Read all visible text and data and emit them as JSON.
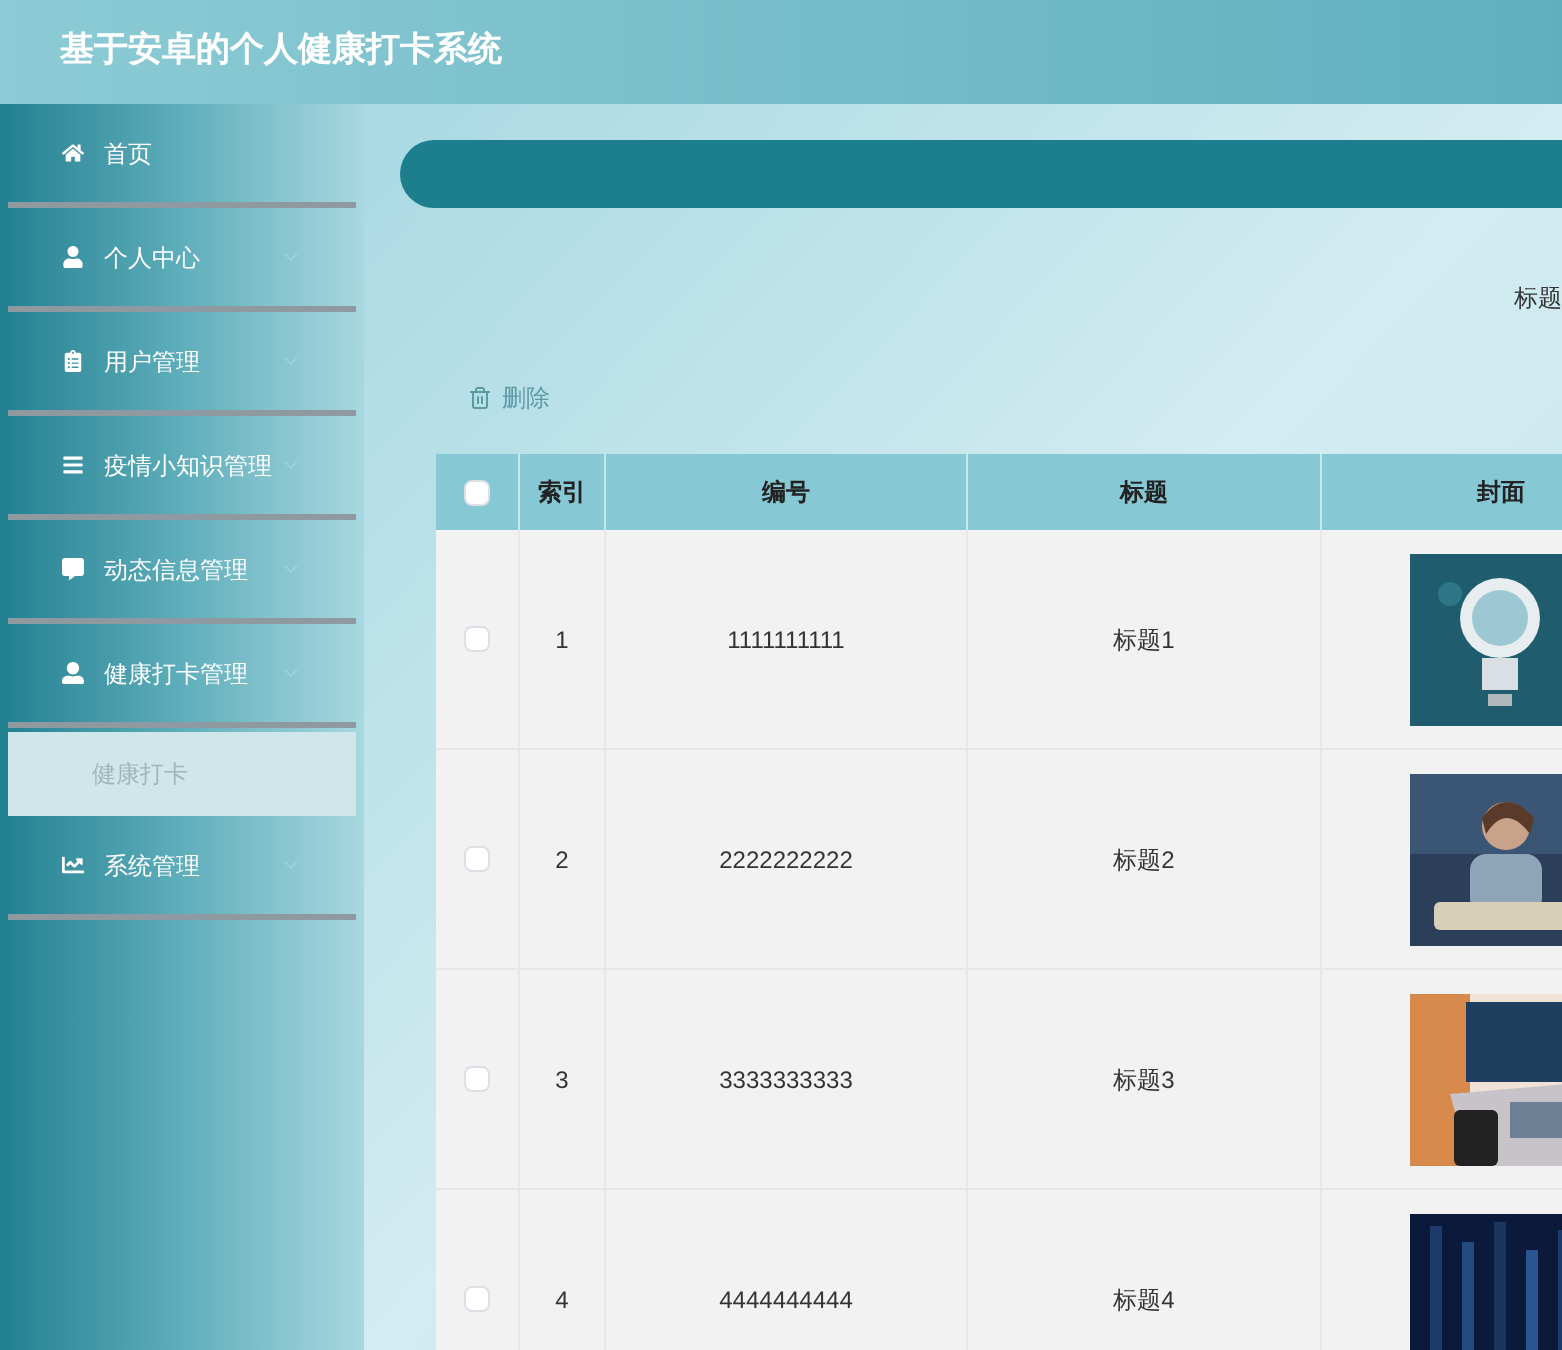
{
  "header": {
    "title": "基于安卓的个人健康打卡系统"
  },
  "sidebar": {
    "items": [
      {
        "label": "首页",
        "expandable": false
      },
      {
        "label": "个人中心",
        "expandable": true
      },
      {
        "label": "用户管理",
        "expandable": true
      },
      {
        "label": "疫情小知识管理",
        "expandable": true
      },
      {
        "label": "动态信息管理",
        "expandable": true
      },
      {
        "label": "健康打卡管理",
        "expandable": true,
        "children": [
          {
            "label": "健康打卡",
            "selected": true
          }
        ]
      },
      {
        "label": "系统管理",
        "expandable": true
      }
    ]
  },
  "search": {
    "label": "标题"
  },
  "toolbar": {
    "delete_button": "删除"
  },
  "table": {
    "header_checked": false,
    "columns": [
      "索引",
      "编号",
      "标题",
      "封面"
    ],
    "rows": [
      {
        "checked": false,
        "cells": [
          "1",
          "1111111111",
          "标题1"
        ],
        "cover": {
          "kind": "picture"
        }
      },
      {
        "checked": false,
        "cells": [
          "2",
          "2222222222",
          "标题2"
        ],
        "cover": {
          "kind": "picture"
        }
      },
      {
        "checked": false,
        "cells": [
          "3",
          "3333333333",
          "标题3"
        ],
        "cover": {
          "kind": "picture"
        }
      },
      {
        "checked": false,
        "cells": [
          "4",
          "4444444444",
          "标题4"
        ],
        "cover": {
          "kind": "picture"
        }
      }
    ]
  }
}
